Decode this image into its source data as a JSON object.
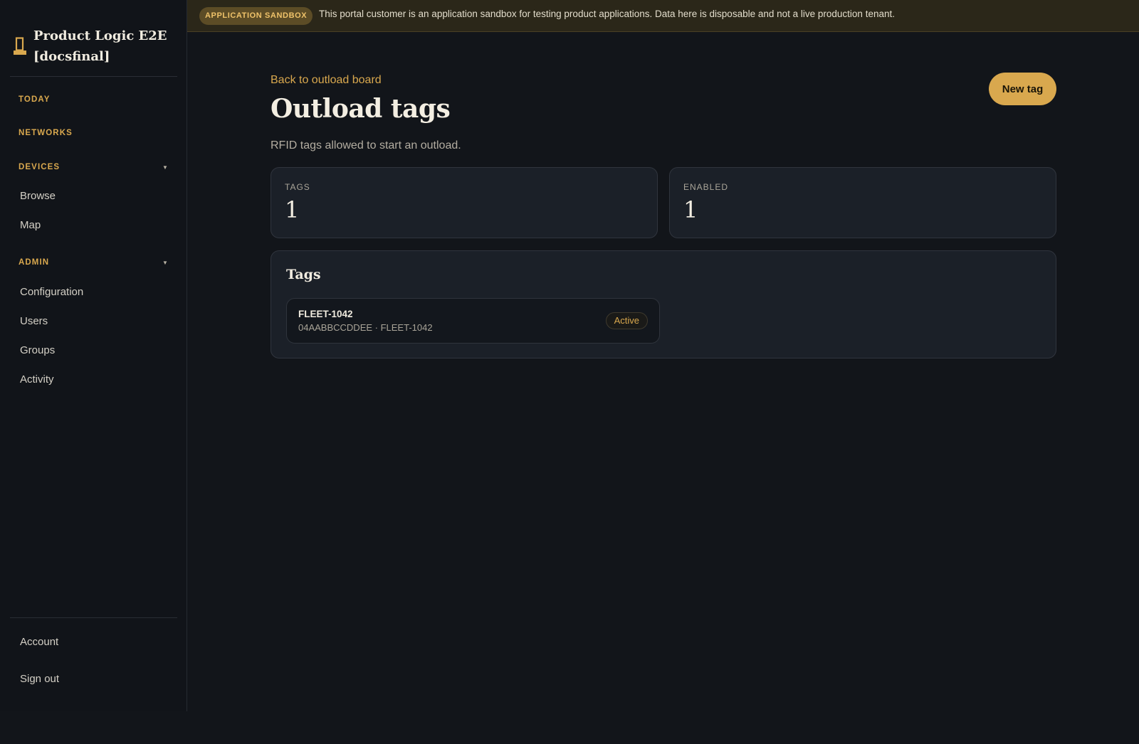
{
  "banner": {
    "badge": "APPLICATION SANDBOX",
    "message": "This portal customer is an application sandbox for testing product applications. Data here is disposable and not a live production tenant."
  },
  "sidebar": {
    "brand_line1": "Product Logic E2E",
    "brand_line2": "[docsfinal]",
    "brand_icon": "device-icon",
    "sections": {
      "today": "TODAY",
      "networks": "NETWORKS",
      "devices": "DEVICES",
      "admin": "ADMIN"
    },
    "devices_items": [
      "Browse",
      "Map"
    ],
    "admin_items": [
      "Configuration",
      "Users",
      "Groups",
      "Activity"
    ],
    "footer_items": [
      "Account",
      "Sign out"
    ]
  },
  "header": {
    "back_link": "Back to outload board",
    "title": "Outload tags",
    "subtitle": "RFID tags allowed to start an outload.",
    "new_button": "New tag"
  },
  "stats": {
    "tags_label": "TAGS",
    "tags_value": "1",
    "enabled_label": "ENABLED",
    "enabled_value": "1"
  },
  "tags_panel": {
    "title": "Tags",
    "rows": [
      {
        "name": "FLEET-1042",
        "meta": "04AABBCCDDEE · FLEET-1042",
        "status": "Active"
      }
    ]
  },
  "colors": {
    "accent": "#d9a84e",
    "background": "#12151a",
    "card": "#1b2028",
    "banner": "#2b2719"
  }
}
